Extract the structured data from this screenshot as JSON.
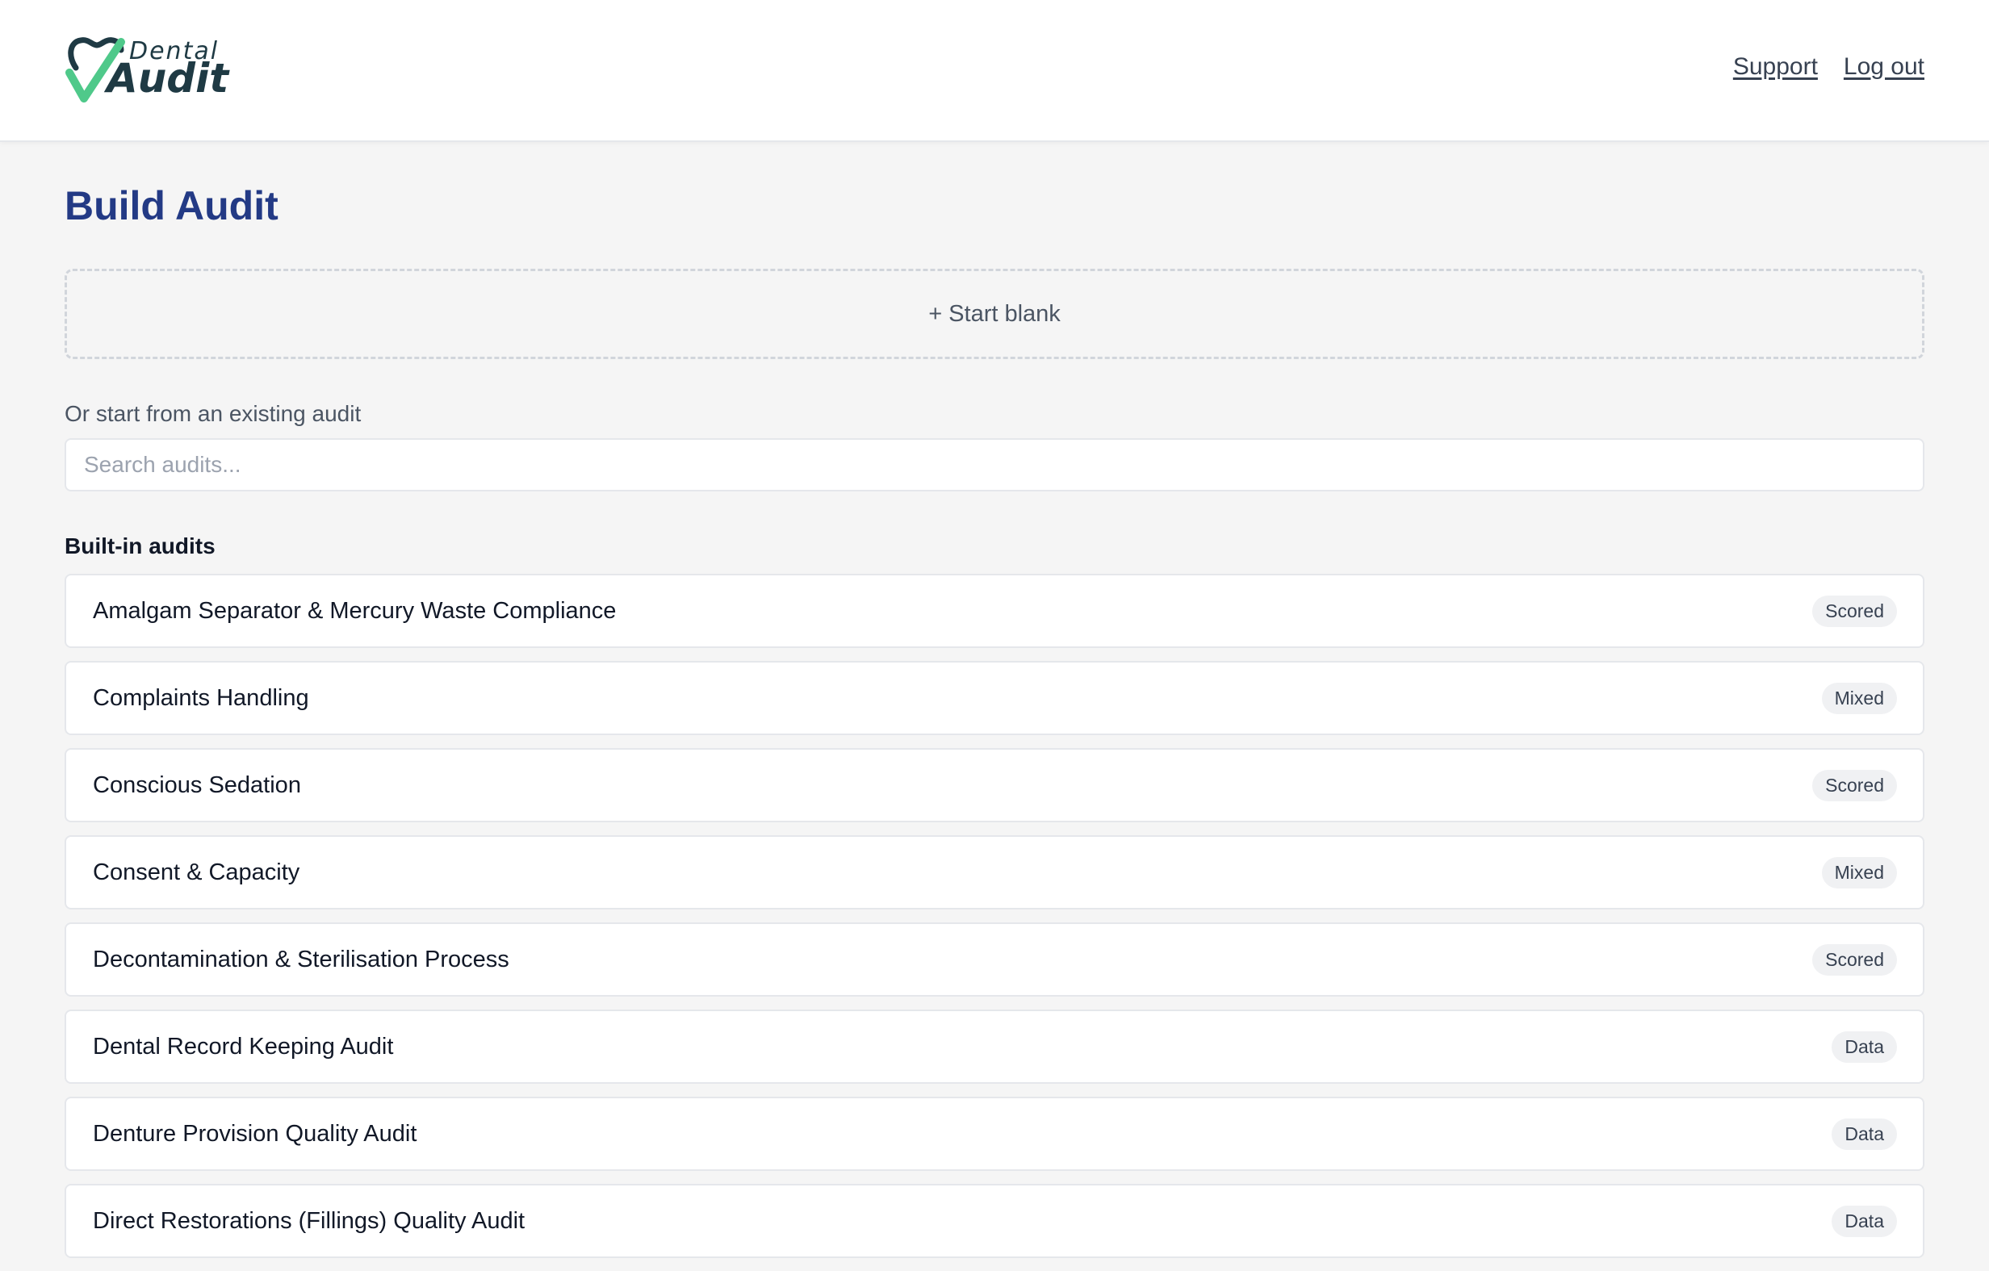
{
  "header": {
    "logo_dental": "Dental",
    "logo_audit": "Audit",
    "nav": {
      "support": "Support",
      "logout": "Log out"
    }
  },
  "main": {
    "title": "Build Audit",
    "start_blank": "+ Start blank",
    "existing_label": "Or start from an existing audit",
    "search_placeholder": "Search audits...",
    "search_value": "",
    "section_title": "Built-in audits",
    "audits": [
      {
        "name": "Amalgam Separator & Mercury Waste Compliance",
        "type": "Scored"
      },
      {
        "name": "Complaints Handling",
        "type": "Mixed"
      },
      {
        "name": "Conscious Sedation",
        "type": "Scored"
      },
      {
        "name": "Consent & Capacity",
        "type": "Mixed"
      },
      {
        "name": "Decontamination & Sterilisation Process",
        "type": "Scored"
      },
      {
        "name": "Dental Record Keeping Audit",
        "type": "Data"
      },
      {
        "name": "Denture Provision Quality Audit",
        "type": "Data"
      },
      {
        "name": "Direct Restorations (Fillings) Quality Audit",
        "type": "Data"
      }
    ]
  },
  "colors": {
    "title": "#233a85",
    "logo_dark": "#1f3a44",
    "logo_check": "#4fc98a",
    "background": "#f5f5f5"
  },
  "icons": {
    "logo": "tooth-check-icon"
  }
}
